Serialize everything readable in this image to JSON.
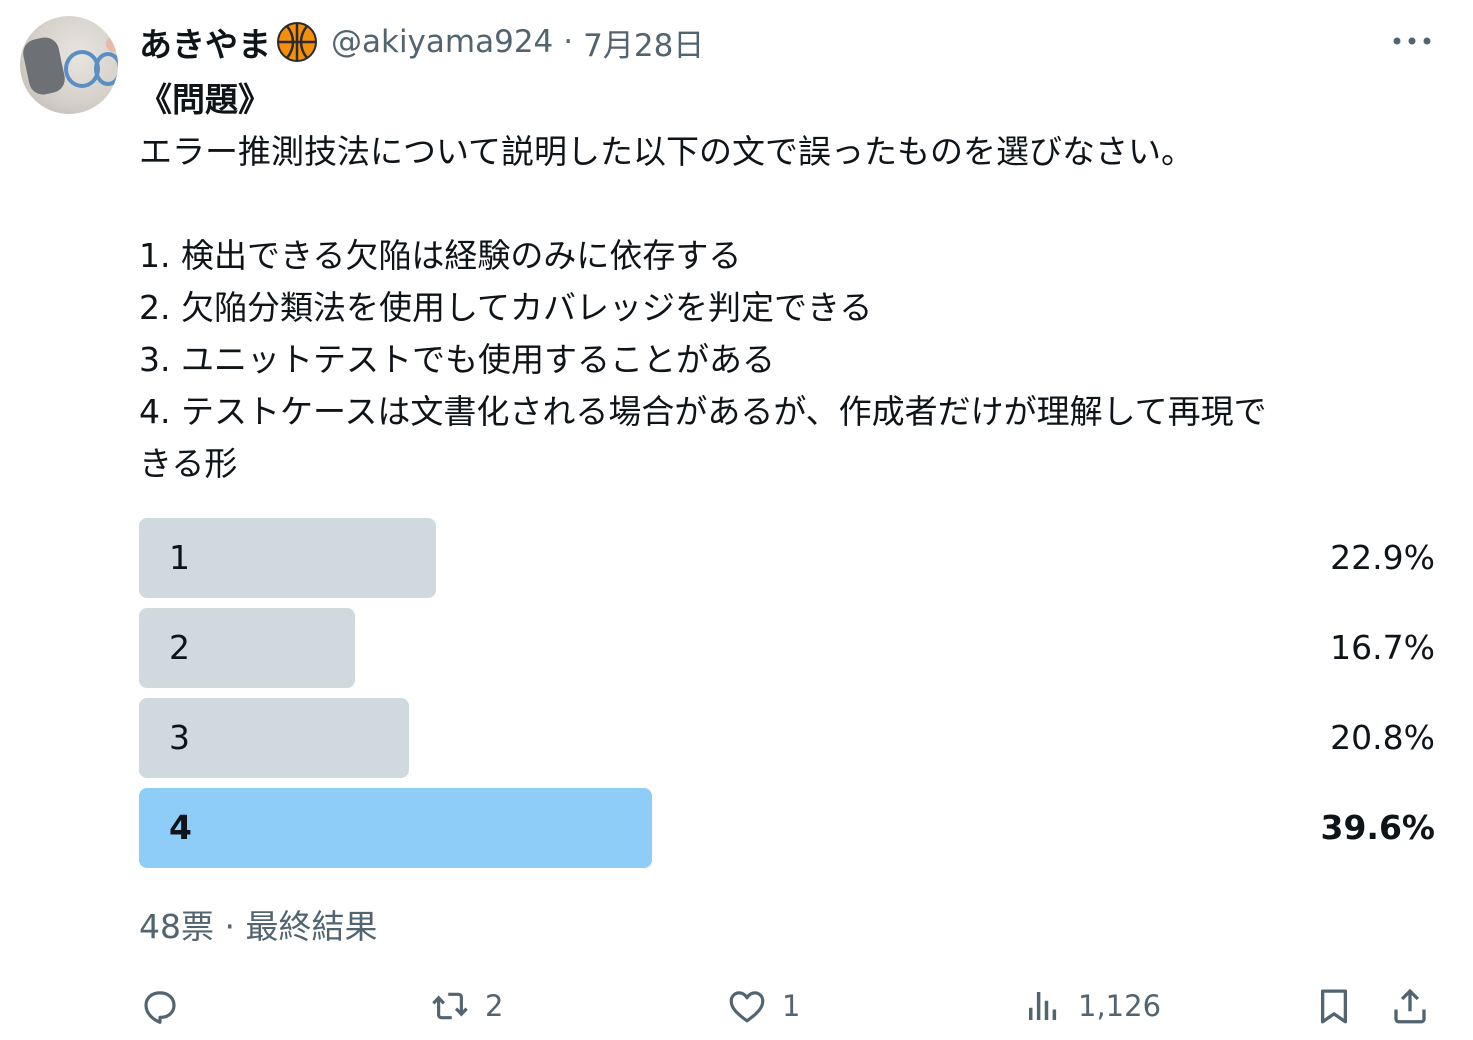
{
  "author": {
    "display_name": "あきやま",
    "emoji_icon": "basketball-icon",
    "handle": "@akiyama924",
    "separator": "·",
    "date": "7月28日"
  },
  "tweet": {
    "lines": [
      "《問題》",
      "エラー推測技法について説明した以下の文で誤ったものを選びなさい。",
      "1. 検出できる欠陥は経験のみに依存する",
      "2. 欠陥分類法を使用してカバレッジを判定できる",
      "3. ユニットテストでも使用することがある",
      "4. テストケースは文書化される場合があるが、作成者だけが理解して再現で",
      "きる形"
    ]
  },
  "poll": {
    "options": [
      {
        "label": "1",
        "percent_text": "22.9%",
        "percent": 22.9,
        "winner": false
      },
      {
        "label": "2",
        "percent_text": "16.7%",
        "percent": 16.7,
        "winner": false
      },
      {
        "label": "3",
        "percent_text": "20.8%",
        "percent": 20.8,
        "winner": false
      },
      {
        "label": "4",
        "percent_text": "39.6%",
        "percent": 39.6,
        "winner": true
      }
    ],
    "votes": "48票",
    "separator": "·",
    "status": "最終結果"
  },
  "actions": {
    "reply_icon": "reply-icon",
    "retweet_icon": "retweet-icon",
    "retweet_count": "2",
    "like_icon": "heart-icon",
    "like_count": "1",
    "views_icon": "views-icon",
    "views_count": "1,126",
    "bookmark_icon": "bookmark-icon",
    "share_icon": "share-icon"
  },
  "colors": {
    "bar_default": "#cfd9de",
    "bar_winner": "#8ecdf8",
    "text_secondary": "#536471",
    "text_primary": "#0f1419"
  }
}
